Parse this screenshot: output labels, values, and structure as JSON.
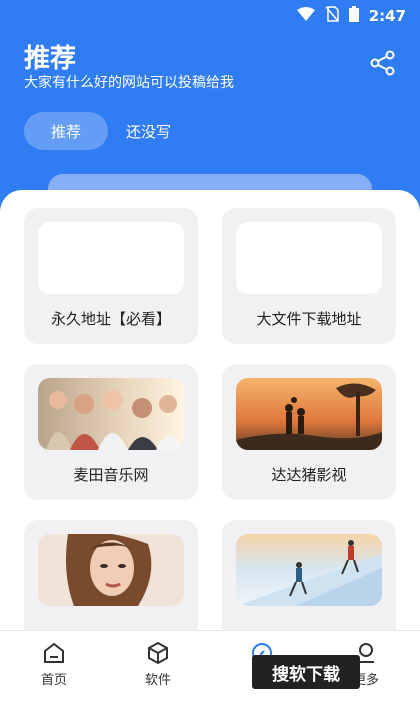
{
  "status_bar": {
    "time": "2:47"
  },
  "header": {
    "title": "推荐",
    "subtitle": "大家有什么好的网站可以投稿给我"
  },
  "tabs": [
    {
      "label": "推荐",
      "active": true
    },
    {
      "label": "还没写",
      "active": false
    }
  ],
  "cards": [
    {
      "label": "永久地址【必看】",
      "image": "blank"
    },
    {
      "label": "大文件下载地址",
      "image": "blank"
    },
    {
      "label": "麦田音乐网",
      "image": "group-photo"
    },
    {
      "label": "达达猪影视",
      "image": "sunset-family"
    },
    {
      "label": "",
      "image": "woman-portrait"
    },
    {
      "label": "",
      "image": "climbers-snow"
    }
  ],
  "bottom_nav": [
    {
      "label": "首页",
      "icon": "home-icon"
    },
    {
      "label": "软件",
      "icon": "cube-icon"
    },
    {
      "label": "",
      "icon": "compass-icon"
    },
    {
      "label": "更多",
      "icon": "person-icon"
    }
  ],
  "watermark": "搜软下载",
  "colors": {
    "brand": "#2f7cf3",
    "panel": "#ffffff",
    "card": "#f1f1f3"
  }
}
